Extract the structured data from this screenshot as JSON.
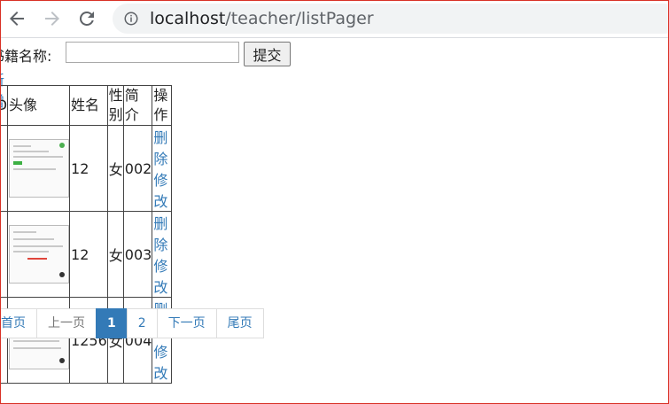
{
  "browser": {
    "url_host": "localhost",
    "url_path": "/teacher/listPager"
  },
  "search": {
    "label": "书籍名称:",
    "input_value": "",
    "submit_label": "提交"
  },
  "add_link": "新增",
  "table": {
    "headers": [
      "ID",
      "头像",
      "姓名",
      "性别",
      "简介",
      "操作"
    ],
    "rows": [
      {
        "id": "",
        "name": "12",
        "gender": "女",
        "intro": "002",
        "delete": "删除",
        "edit": "修改"
      },
      {
        "id": "",
        "name": "12",
        "gender": "女",
        "intro": "003",
        "delete": "删除",
        "edit": "修改"
      },
      {
        "id": "",
        "name": "1256",
        "gender": "女",
        "intro": "004",
        "delete": "删除",
        "edit": "修改"
      }
    ]
  },
  "pager": {
    "first": "首页",
    "prev": "上一页",
    "pages": [
      "1",
      "2"
    ],
    "current": "1",
    "next": "下一页",
    "last": "尾页"
  },
  "colors": {
    "link": "#337ab7",
    "active_page_bg": "#337ab7",
    "frame_border": "#d93025"
  },
  "icons": [
    "back-arrow-icon",
    "forward-arrow-icon",
    "reload-icon",
    "info-icon"
  ]
}
